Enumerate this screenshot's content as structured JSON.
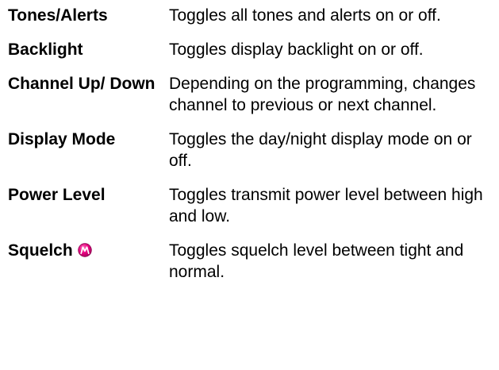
{
  "features": [
    {
      "term": "Tones/Alerts",
      "definition": "Toggles all tones and alerts on or off."
    },
    {
      "term": "Backlight",
      "definition": "Toggles display backlight on or off."
    },
    {
      "term": "Channel Up/ Down",
      "definition": "Depending on the programming, changes channel to previous or next channel."
    },
    {
      "term": "Display Mode",
      "definition": "Toggles the day/night display mode on or off."
    },
    {
      "term": "Power Level",
      "definition": "Toggles transmit power level between high and low."
    },
    {
      "term": "Squelch",
      "icon": "motorola-logo-icon",
      "icon_color": "#e6007e",
      "definition": "Toggles squelch level between tight and normal."
    }
  ]
}
